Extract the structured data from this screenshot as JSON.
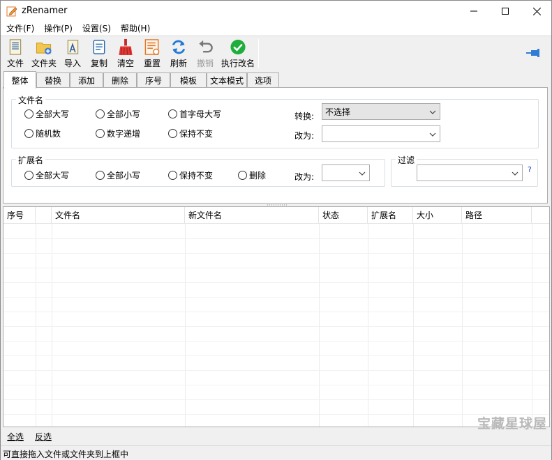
{
  "window": {
    "title": "zRenamer"
  },
  "menu": [
    "文件(F)",
    "操作(P)",
    "设置(S)",
    "帮助(H)"
  ],
  "toolbar": {
    "file": "文件",
    "folder": "文件夹",
    "import": "导入",
    "copy": "复制",
    "clear": "清空",
    "reset": "重置",
    "refresh": "刷新",
    "undo": "撤销",
    "execute": "执行改名"
  },
  "tabs": [
    "整体",
    "替换",
    "添加",
    "删除",
    "序号",
    "模板",
    "文本模式",
    "选项"
  ],
  "filename_group": {
    "legend": "文件名",
    "options": [
      "全部大写",
      "全部小写",
      "首字母大写",
      "随机数",
      "数字递增",
      "保持不变"
    ],
    "convert_label": "转换:",
    "convert_value": "不选择",
    "change_label": "改为:",
    "change_value": ""
  },
  "ext_group": {
    "legend": "扩展名",
    "options": [
      "全部大写",
      "全部小写",
      "保持不变",
      "删除"
    ],
    "change_label": "改为:",
    "change_value": ""
  },
  "filter_group": {
    "legend": "过滤",
    "value": "",
    "help": "?"
  },
  "grid": {
    "columns": [
      "序号",
      "",
      "文件名",
      "新文件名",
      "状态",
      "扩展名",
      "大小",
      "路径"
    ]
  },
  "bottom_links": {
    "select_all": "全选",
    "invert": "反选"
  },
  "status": "可直接拖入文件或文件夹到上框中",
  "watermark": "宝藏星球屋"
}
